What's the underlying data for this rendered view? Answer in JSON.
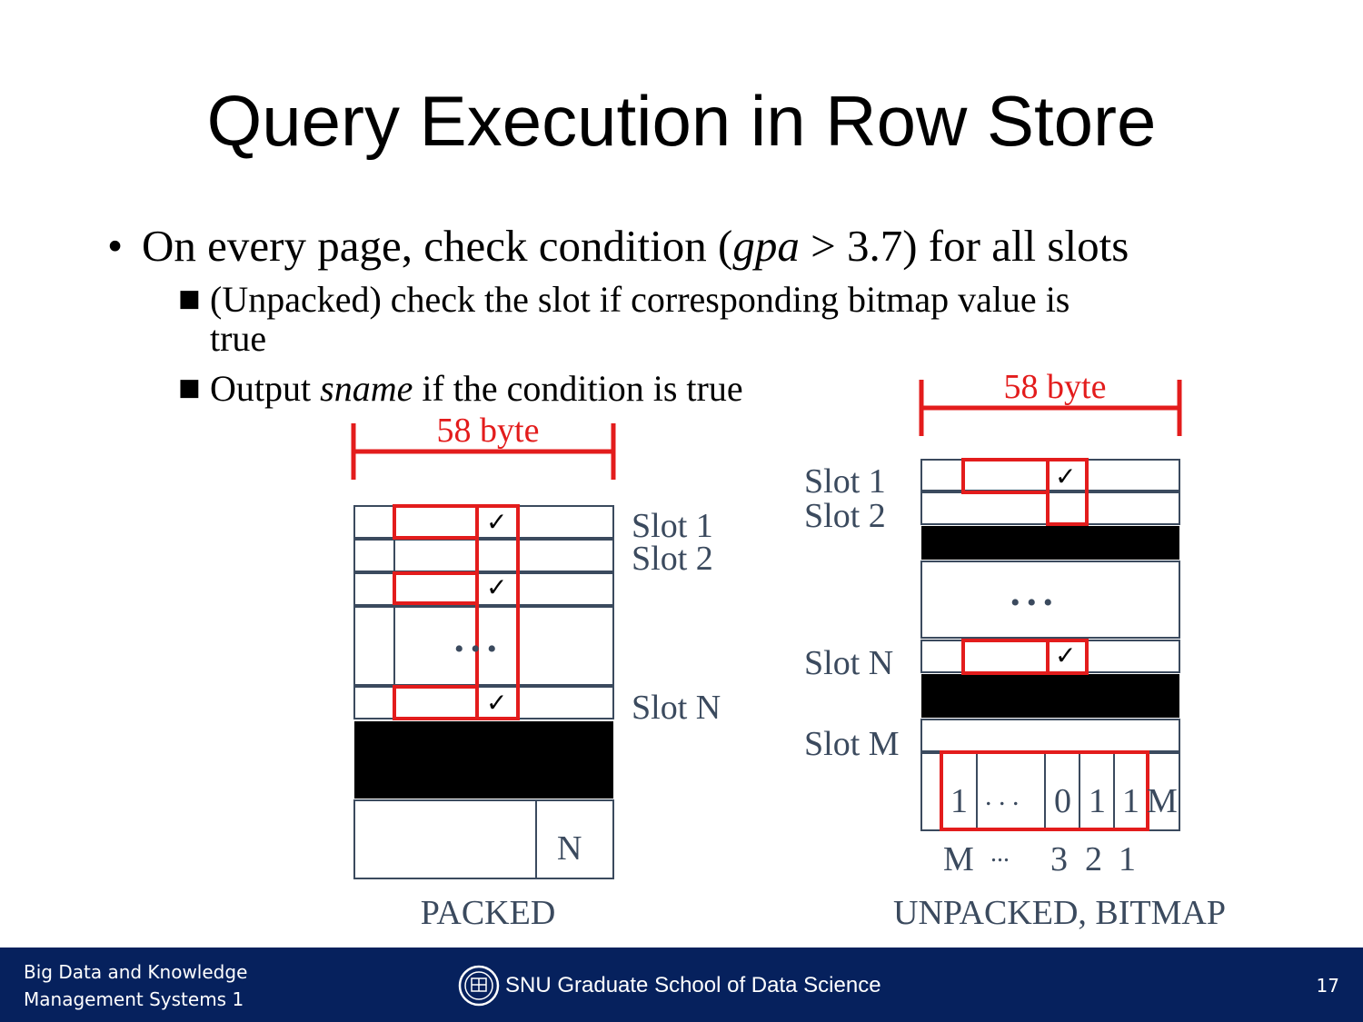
{
  "slide": {
    "title": "Query Execution in Row Store",
    "bullet_main_a": "On every page, check condition (",
    "bullet_main_italic": "gpa",
    "bullet_main_b": " > 3.7) for all slots",
    "sub1_line1": "(Unpacked) check the slot if corresponding bitmap value is",
    "sub1_line2": "true",
    "sub2_a": "Output ",
    "sub2_italic": "sname",
    "sub2_b": " if the condition is true"
  },
  "packed": {
    "width_label": "58 byte",
    "slot1": "Slot 1",
    "slot2": "Slot 2",
    "slotN": "Slot N",
    "ellipsis": "• • •",
    "footer_value": "N",
    "caption": "PACKED",
    "check": "✓"
  },
  "unpacked": {
    "width_label": "58 byte",
    "slot1": "Slot 1",
    "slot2": "Slot 2",
    "slotN": "Slot N",
    "slotM": "Slot M",
    "ellipsis": "• • •",
    "bitmap_values": [
      "1",
      ". . .",
      "0",
      "1",
      "1",
      "M"
    ],
    "bitmap_indices": [
      "M",
      "...",
      "3",
      "2",
      "1"
    ],
    "caption": "UNPACKED, BITMAP",
    "check": "✓"
  },
  "footer": {
    "course_line1": "Big Data and Knowledge",
    "course_line2": "Management Systems 1",
    "school": "SNU Graduate School of Data Science",
    "page_number": "17"
  },
  "colors": {
    "highlight": "#e31c1c",
    "footer_bg": "#06215d",
    "label_text": "#3b4a5e",
    "grid_line": "#3b4a5e"
  },
  "icons": [
    "snu-logo-icon",
    "check-icon"
  ]
}
